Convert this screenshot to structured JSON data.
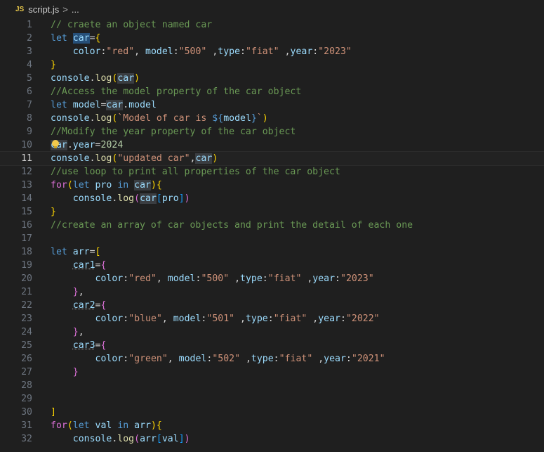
{
  "breadcrumb": {
    "file_icon": "JS",
    "file_name": "script.js",
    "separator": ">",
    "trail": "..."
  },
  "editor": {
    "current_line": 11,
    "lines": [
      {
        "n": "1",
        "tokens": [
          [
            "cm",
            "// craete an object named car"
          ]
        ]
      },
      {
        "n": "2",
        "tokens": [
          [
            "kw",
            "let "
          ],
          [
            "var hl",
            "car"
          ],
          [
            "pl",
            "="
          ],
          [
            "br1",
            "{"
          ]
        ]
      },
      {
        "n": "3",
        "tokens": [
          [
            "pl",
            "    "
          ],
          [
            "var",
            "color"
          ],
          [
            "pl",
            ":"
          ],
          [
            "str",
            "\"red\""
          ],
          [
            "pl",
            ", "
          ],
          [
            "var",
            "model"
          ],
          [
            "pl",
            ":"
          ],
          [
            "str",
            "\"500\""
          ],
          [
            "pl",
            " ,"
          ],
          [
            "var",
            "type"
          ],
          [
            "pl",
            ":"
          ],
          [
            "str",
            "\"fiat\""
          ],
          [
            "pl",
            " ,"
          ],
          [
            "var",
            "year"
          ],
          [
            "pl",
            ":"
          ],
          [
            "str",
            "\"2023\""
          ]
        ]
      },
      {
        "n": "4",
        "tokens": [
          [
            "br1",
            "}"
          ]
        ]
      },
      {
        "n": "5",
        "tokens": [
          [
            "var",
            "console"
          ],
          [
            "pl",
            "."
          ],
          [
            "fn",
            "log"
          ],
          [
            "br1",
            "("
          ],
          [
            "var hl2",
            "car"
          ],
          [
            "br1",
            ")"
          ]
        ]
      },
      {
        "n": "6",
        "tokens": [
          [
            "cm",
            "//Access the model property of the car object"
          ]
        ]
      },
      {
        "n": "7",
        "tokens": [
          [
            "kw",
            "let "
          ],
          [
            "var",
            "model"
          ],
          [
            "pl",
            "="
          ],
          [
            "var hl2",
            "car"
          ],
          [
            "pl",
            "."
          ],
          [
            "var",
            "model"
          ]
        ]
      },
      {
        "n": "8",
        "tokens": [
          [
            "var",
            "console"
          ],
          [
            "pl",
            "."
          ],
          [
            "fn",
            "log"
          ],
          [
            "br1",
            "("
          ],
          [
            "str",
            "`Model of car is "
          ],
          [
            "kw",
            "${"
          ],
          [
            "var",
            "model"
          ],
          [
            "kw",
            "}"
          ],
          [
            "str",
            "`"
          ],
          [
            "br1",
            ")"
          ]
        ]
      },
      {
        "n": "9",
        "tokens": [
          [
            "cm",
            "//Modify the year property of the car object"
          ]
        ]
      },
      {
        "n": "10",
        "tokens": [
          [
            "var hl2",
            "car"
          ],
          [
            "pl",
            "."
          ],
          [
            "var",
            "year"
          ],
          [
            "pl",
            "="
          ],
          [
            "num",
            "2024"
          ]
        ]
      },
      {
        "n": "11",
        "tokens": [
          [
            "var",
            "console"
          ],
          [
            "pl",
            "."
          ],
          [
            "fn",
            "log"
          ],
          [
            "br1",
            "("
          ],
          [
            "str",
            "\"updated car\""
          ],
          [
            "pl",
            ","
          ],
          [
            "var hl2",
            "car"
          ],
          [
            "br1",
            ")"
          ]
        ]
      },
      {
        "n": "12",
        "tokens": [
          [
            "cm",
            "//use loop to print all properties of the car object"
          ]
        ]
      },
      {
        "n": "13",
        "tokens": [
          [
            "br2",
            "for"
          ],
          [
            "br1",
            "("
          ],
          [
            "kw",
            "let "
          ],
          [
            "var",
            "pro "
          ],
          [
            "kw",
            "in "
          ],
          [
            "var hl2",
            "car"
          ],
          [
            "br1",
            ")"
          ],
          [
            "br1",
            "{"
          ]
        ]
      },
      {
        "n": "14",
        "tokens": [
          [
            "pl",
            "    "
          ],
          [
            "var",
            "console"
          ],
          [
            "pl",
            "."
          ],
          [
            "fn",
            "log"
          ],
          [
            "br2",
            "("
          ],
          [
            "var hl2",
            "car"
          ],
          [
            "br3",
            "["
          ],
          [
            "var",
            "pro"
          ],
          [
            "br3",
            "]"
          ],
          [
            "br2",
            ")"
          ]
        ]
      },
      {
        "n": "15",
        "tokens": [
          [
            "br1",
            "}"
          ]
        ]
      },
      {
        "n": "16",
        "tokens": [
          [
            "cm",
            "//create an array of car objects and print the detail of each one"
          ]
        ]
      },
      {
        "n": "17",
        "tokens": []
      },
      {
        "n": "18",
        "tokens": [
          [
            "kw",
            "let "
          ],
          [
            "var",
            "arr"
          ],
          [
            "pl",
            "="
          ],
          [
            "br1",
            "["
          ]
        ]
      },
      {
        "n": "19",
        "tokens": [
          [
            "pl",
            "    "
          ],
          [
            "var dots",
            "car1"
          ],
          [
            "pl",
            "="
          ],
          [
            "br2",
            "{"
          ]
        ]
      },
      {
        "n": "20",
        "tokens": [
          [
            "pl",
            "        "
          ],
          [
            "var",
            "color"
          ],
          [
            "pl",
            ":"
          ],
          [
            "str",
            "\"red\""
          ],
          [
            "pl",
            ", "
          ],
          [
            "var",
            "model"
          ],
          [
            "pl",
            ":"
          ],
          [
            "str",
            "\"500\""
          ],
          [
            "pl",
            " ,"
          ],
          [
            "var",
            "type"
          ],
          [
            "pl",
            ":"
          ],
          [
            "str",
            "\"fiat\""
          ],
          [
            "pl",
            " ,"
          ],
          [
            "var",
            "year"
          ],
          [
            "pl",
            ":"
          ],
          [
            "str",
            "\"2023\""
          ]
        ]
      },
      {
        "n": "21",
        "tokens": [
          [
            "pl",
            "    "
          ],
          [
            "br2",
            "}"
          ],
          [
            "pl",
            ","
          ]
        ]
      },
      {
        "n": "22",
        "tokens": [
          [
            "pl",
            "    "
          ],
          [
            "var dots",
            "car2"
          ],
          [
            "pl",
            "="
          ],
          [
            "br2",
            "{"
          ]
        ]
      },
      {
        "n": "23",
        "tokens": [
          [
            "pl",
            "        "
          ],
          [
            "var",
            "color"
          ],
          [
            "pl",
            ":"
          ],
          [
            "str",
            "\"blue\""
          ],
          [
            "pl",
            ", "
          ],
          [
            "var",
            "model"
          ],
          [
            "pl",
            ":"
          ],
          [
            "str",
            "\"501\""
          ],
          [
            "pl",
            " ,"
          ],
          [
            "var",
            "type"
          ],
          [
            "pl",
            ":"
          ],
          [
            "str",
            "\"fiat\""
          ],
          [
            "pl",
            " ,"
          ],
          [
            "var",
            "year"
          ],
          [
            "pl",
            ":"
          ],
          [
            "str",
            "\"2022\""
          ]
        ]
      },
      {
        "n": "24",
        "tokens": [
          [
            "pl",
            "    "
          ],
          [
            "br2",
            "}"
          ],
          [
            "pl",
            ","
          ]
        ]
      },
      {
        "n": "25",
        "tokens": [
          [
            "pl",
            "    "
          ],
          [
            "var dots",
            "car3"
          ],
          [
            "pl",
            "="
          ],
          [
            "br2",
            "{"
          ]
        ]
      },
      {
        "n": "26",
        "tokens": [
          [
            "pl",
            "        "
          ],
          [
            "var",
            "color"
          ],
          [
            "pl",
            ":"
          ],
          [
            "str",
            "\"green\""
          ],
          [
            "pl",
            ", "
          ],
          [
            "var",
            "model"
          ],
          [
            "pl",
            ":"
          ],
          [
            "str",
            "\"502\""
          ],
          [
            "pl",
            " ,"
          ],
          [
            "var",
            "type"
          ],
          [
            "pl",
            ":"
          ],
          [
            "str",
            "\"fiat\""
          ],
          [
            "pl",
            " ,"
          ],
          [
            "var",
            "year"
          ],
          [
            "pl",
            ":"
          ],
          [
            "str",
            "\"2021\""
          ]
        ]
      },
      {
        "n": "27",
        "tokens": [
          [
            "pl",
            "    "
          ],
          [
            "br2",
            "}"
          ]
        ]
      },
      {
        "n": "28",
        "tokens": []
      },
      {
        "n": "29",
        "tokens": []
      },
      {
        "n": "30",
        "tokens": [
          [
            "br1",
            "]"
          ]
        ]
      },
      {
        "n": "31",
        "tokens": [
          [
            "br2",
            "for"
          ],
          [
            "br1",
            "("
          ],
          [
            "kw",
            "let "
          ],
          [
            "var",
            "val "
          ],
          [
            "kw",
            "in "
          ],
          [
            "var",
            "arr"
          ],
          [
            "br1",
            ")"
          ],
          [
            "br1",
            "{"
          ]
        ]
      },
      {
        "n": "32",
        "tokens": [
          [
            "pl",
            "    "
          ],
          [
            "var",
            "console"
          ],
          [
            "pl",
            "."
          ],
          [
            "fn",
            "log"
          ],
          [
            "br2",
            "("
          ],
          [
            "var",
            "arr"
          ],
          [
            "br3",
            "["
          ],
          [
            "var",
            "val"
          ],
          [
            "br3",
            "]"
          ],
          [
            "br2",
            ")"
          ]
        ]
      }
    ]
  },
  "icons": {
    "lightbulb": "lightbulb-icon",
    "chevron": "chevron-right-icon"
  }
}
